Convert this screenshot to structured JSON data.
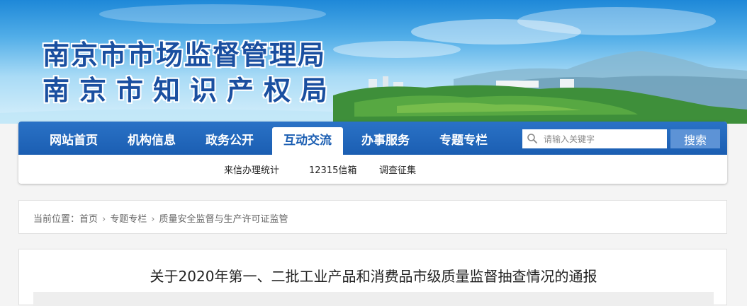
{
  "banner": {
    "title_line1": "南京市市场监督管理局",
    "title_line2": "南京市知识产权局"
  },
  "nav": {
    "items": [
      {
        "label": "网站首页",
        "active": false
      },
      {
        "label": "机构信息",
        "active": false
      },
      {
        "label": "政务公开",
        "active": false
      },
      {
        "label": "互动交流",
        "active": true
      },
      {
        "label": "办事服务",
        "active": false
      },
      {
        "label": "专题专栏",
        "active": false
      }
    ],
    "search_placeholder": "请输入关键字",
    "search_button": "搜索"
  },
  "subnav": {
    "items": [
      "来信办理统计",
      "12315信箱",
      "调查征集"
    ]
  },
  "breadcrumb": {
    "prefix": "当前位置：",
    "items": [
      "首页",
      "专题专栏",
      "质量安全监督与生产许可证监管"
    ],
    "separator": "›"
  },
  "article": {
    "title": "关于2020年第一、二批工业产品和消费品市级质量监督抽查情况的通报"
  },
  "colors": {
    "nav_blue": "#1b5eb2",
    "title_blue": "#1a4fa0"
  }
}
